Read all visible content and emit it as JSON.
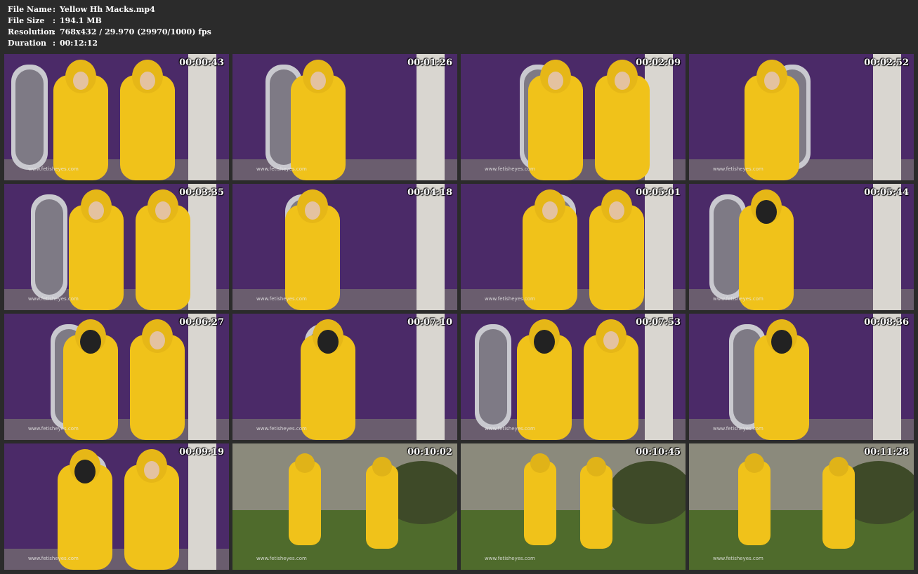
{
  "meta": {
    "rows": [
      {
        "label": "File Name",
        "sep": ":",
        "value": "Yellow Hh Macks.mp4"
      },
      {
        "label": "File Size",
        "sep": ":",
        "value": "194.1 MB"
      },
      {
        "label": "Resolution",
        "sep": ":",
        "value": "768x432 / 29.970 (29970/1000) fps"
      },
      {
        "label": "Duration",
        "sep": ":",
        "value": "00:12:12"
      }
    ]
  },
  "watermark": "www.fetisheyes.com",
  "colors": {
    "background": "#2b2b2b",
    "wall": "#4b2a68",
    "raincoat": "#f0c21a",
    "grass": "#4f6b2c"
  },
  "thumbnails": [
    {
      "time": "00:00:43",
      "scene": "indoor"
    },
    {
      "time": "00:01:26",
      "scene": "indoor"
    },
    {
      "time": "00:02:09",
      "scene": "indoor"
    },
    {
      "time": "00:02:52",
      "scene": "indoor"
    },
    {
      "time": "00:03:35",
      "scene": "indoor"
    },
    {
      "time": "00:04:18",
      "scene": "indoor"
    },
    {
      "time": "00:05:01",
      "scene": "indoor"
    },
    {
      "time": "00:05:44",
      "scene": "indoor"
    },
    {
      "time": "00:06:27",
      "scene": "indoor"
    },
    {
      "time": "00:07:10",
      "scene": "indoor"
    },
    {
      "time": "00:07:53",
      "scene": "indoor"
    },
    {
      "time": "00:08:36",
      "scene": "indoor"
    },
    {
      "time": "00:09:19",
      "scene": "indoor"
    },
    {
      "time": "00:10:02",
      "scene": "garden"
    },
    {
      "time": "00:10:45",
      "scene": "garden"
    },
    {
      "time": "00:11:28",
      "scene": "garden"
    }
  ]
}
